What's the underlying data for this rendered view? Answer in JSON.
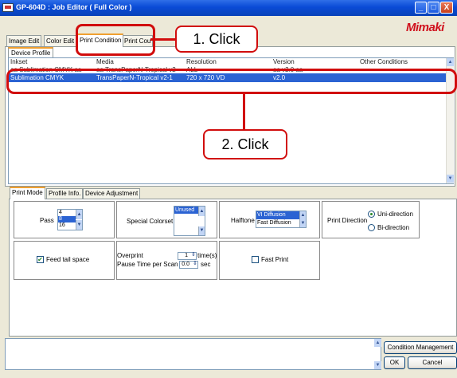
{
  "window": {
    "title": "GP-604D : Job Editor ( Full Color )",
    "brand": "Mimaki",
    "min": "_",
    "max": "□",
    "close": "X"
  },
  "tabs": [
    {
      "label": "Image Edit"
    },
    {
      "label": "Color Edit"
    },
    {
      "label": "Print Condition"
    },
    {
      "label": "Print Cou"
    }
  ],
  "subtab": {
    "label": "Device Profile"
  },
  "table": {
    "columns": [
      "Inkset",
      "Media",
      "Resolution",
      "Version",
      "Other Conditions"
    ],
    "rows": [
      {
        "inkset": "aa Sublimation CMYK aa",
        "media": "aa TransPaperN-Tropical v2",
        "resolution": "ALL",
        "version": "aa v2.0 aa",
        "other": ""
      },
      {
        "inkset": "Sublimation CMYK",
        "media": "TransPaperN-Tropical v2-1",
        "resolution": "720 x 720 VD",
        "version": "v2.0",
        "other": ""
      }
    ]
  },
  "callouts": {
    "step1": "1. Click",
    "step2": "2. Click"
  },
  "bottom_tabs": [
    {
      "label": "Print Mode"
    },
    {
      "label": "Profile Info."
    },
    {
      "label": "Device Adjustment"
    }
  ],
  "print_mode": {
    "pass": {
      "label": "Pass",
      "options": [
        "4",
        "8",
        "16"
      ],
      "selected": "8"
    },
    "special_colorset": {
      "label": "Special Colorset",
      "options": [
        "Unused"
      ],
      "selected": "Unused"
    },
    "halftone": {
      "label": "Halftone",
      "options": [
        "VI Diffusion",
        "Fast Diffusion"
      ],
      "selected": "VI Diffusion"
    },
    "print_direction": {
      "label": "Print Direction",
      "options": [
        "Uni-direction",
        "Bi-direction"
      ],
      "selected": "Uni-direction"
    },
    "feed_tail_space": {
      "label": "Feed tail space",
      "checked": true
    },
    "overprint": {
      "label": "Overprint",
      "value": "1",
      "unit": "time(s)"
    },
    "pause_time": {
      "label": "Pause Time per Scan",
      "value": "0.0",
      "unit": "sec"
    },
    "fast_print": {
      "label": "Fast Print",
      "checked": false
    }
  },
  "footer": {
    "condition_management": "Condition Management",
    "ok": "OK",
    "cancel": "Cancel"
  },
  "colors": {
    "titlebar": "#0a4bd6",
    "selection": "#2b63d3",
    "callout": "#d10d0d",
    "brand": "#d0101c"
  }
}
